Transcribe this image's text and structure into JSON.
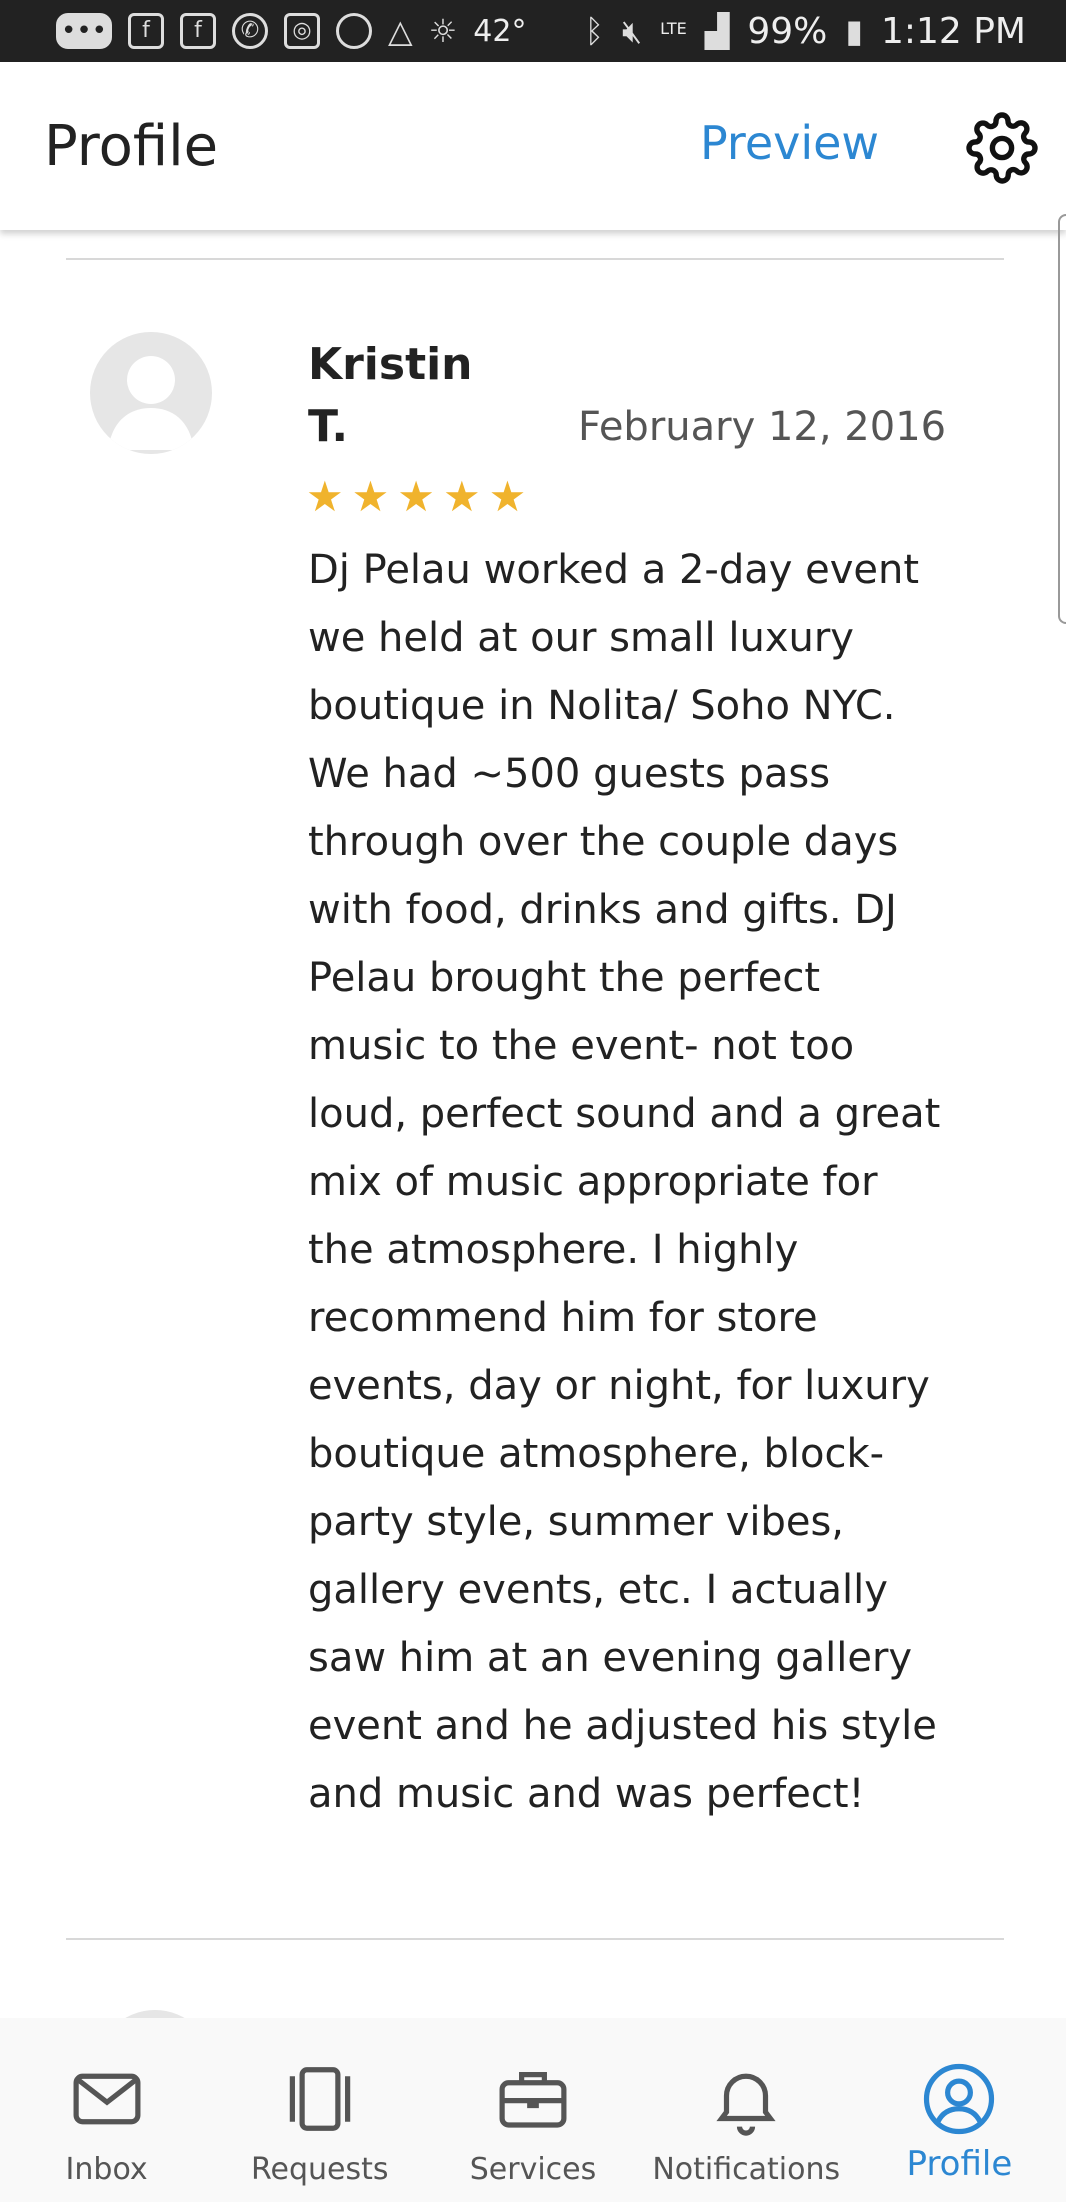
{
  "status_bar": {
    "temperature": "42°",
    "network": "LTE",
    "battery": "99%",
    "time": "1:12 PM"
  },
  "header": {
    "title": "Profile",
    "preview_label": "Preview",
    "settings_icon": "gear-icon"
  },
  "review": {
    "reviewer_name": "Kristin T.",
    "date": "February 12, 2016",
    "rating": 5,
    "rating_max": 5,
    "stars": "★★★★★",
    "text": "Dj Pelau worked a 2-day event we held at our small luxury boutique in Nolita/ Soho NYC. We had ~500 guests pass through over the couple days with food, drinks and gifts. DJ Pelau brought the perfect music to the event- not too loud, perfect sound and a great mix of music appropriate for the atmosphere. I highly recommend him for store events, day or night, for luxury boutique atmosphere, block-party style, summer vibes, gallery events, etc. I actually saw him at an evening gallery event and he adjusted his style and music and was perfect!"
  },
  "tabs": [
    {
      "label": "Inbox",
      "icon": "envelope-icon"
    },
    {
      "label": "Requests",
      "icon": "requests-icon"
    },
    {
      "label": "Services",
      "icon": "briefcase-icon"
    },
    {
      "label": "Notifications",
      "icon": "bell-icon"
    },
    {
      "label": "Profile",
      "icon": "user-circle-icon",
      "active": true
    }
  ],
  "colors": {
    "accent": "#2c87d2",
    "star": "#f0b32d",
    "status_bar": "#222222"
  }
}
